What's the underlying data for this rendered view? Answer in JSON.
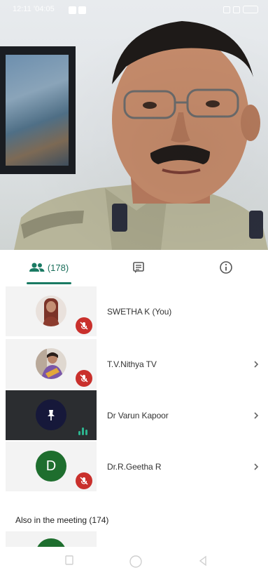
{
  "status_bar": {
    "time": "12:11 ’04:05"
  },
  "tabs": {
    "people_count": "(178)",
    "people_icon": "people-icon",
    "chat_icon": "chat-icon",
    "info_icon": "info-icon",
    "active": "people"
  },
  "participants": [
    {
      "name": "SWETHA K (You)",
      "avatar": "photo",
      "muted": true,
      "has_chevron": false
    },
    {
      "name": "T.V.Nithya TV",
      "avatar": "photo",
      "muted": true,
      "has_chevron": true
    },
    {
      "name": "Dr Varun Kapoor",
      "avatar": "pin",
      "muted": false,
      "speaking": true,
      "has_chevron": true
    },
    {
      "name": "Dr.R.Geetha R",
      "avatar": "letter",
      "avatar_letter": "D",
      "muted": true,
      "has_chevron": true
    }
  ],
  "also_in_meeting": "Also in the meeting (174)",
  "colors": {
    "accent": "#1a7a63",
    "mute_red": "#c9302c",
    "avatar_green": "#1e6e2e",
    "speaking_green": "#2db48f"
  }
}
